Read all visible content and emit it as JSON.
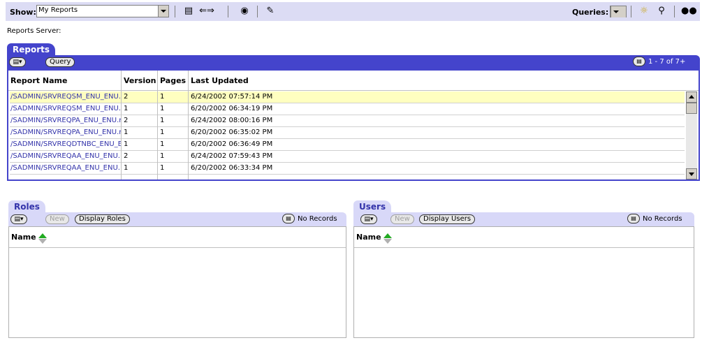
{
  "toolbar": {
    "show_label": "Show:",
    "show_value": "My Reports",
    "queries_label": "Queries:",
    "icons": [
      "scroll-icon",
      "back-forward-icon",
      "globe-icon",
      "edit-icon",
      "new-query-icon",
      "find-icon",
      "binoculars-icon"
    ]
  },
  "server_label": "Reports Server:",
  "reports": {
    "tab": "Reports",
    "query_button": "Query",
    "pager": "1 - 7 of 7+",
    "columns": [
      "Report Name",
      "Version",
      "Pages",
      "Last Updated"
    ],
    "rows": [
      {
        "name": "/SADMIN/SRVREQSM_ENU_ENU.r",
        "version": "2",
        "pages": "1",
        "updated": "6/24/2002 07:57:14 PM"
      },
      {
        "name": "/SADMIN/SRVREQSM_ENU_ENU.r",
        "version": "1",
        "pages": "1",
        "updated": "6/20/2002 06:34:19 PM"
      },
      {
        "name": "/SADMIN/SRVREQPA_ENU_ENU.r",
        "version": "2",
        "pages": "1",
        "updated": "6/24/2002 08:00:16 PM"
      },
      {
        "name": "/SADMIN/SRVREQPA_ENU_ENU.r",
        "version": "1",
        "pages": "1",
        "updated": "6/20/2002 06:35:02 PM"
      },
      {
        "name": "/SADMIN/SRVREQDTNBC_ENU_E",
        "version": "1",
        "pages": "1",
        "updated": "6/20/2002 06:36:49 PM"
      },
      {
        "name": "/SADMIN/SRVREQAA_ENU_ENU.",
        "version": "2",
        "pages": "1",
        "updated": "6/24/2002 07:59:43 PM"
      },
      {
        "name": "/SADMIN/SRVREQAA_ENU_ENU.",
        "version": "1",
        "pages": "1",
        "updated": "6/20/2002 06:33:34 PM"
      }
    ]
  },
  "roles": {
    "tab": "Roles",
    "new_button": "New",
    "display_button": "Display Roles",
    "records": "No Records",
    "column": "Name"
  },
  "users": {
    "tab": "Users",
    "new_button": "New",
    "display_button": "Display Users",
    "records": "No Records",
    "column": "Name"
  },
  "colors": {
    "accent": "#4444cc",
    "toolbar": "#dcdcf4",
    "selected_row": "#ffffc0",
    "link": "#3333aa"
  }
}
